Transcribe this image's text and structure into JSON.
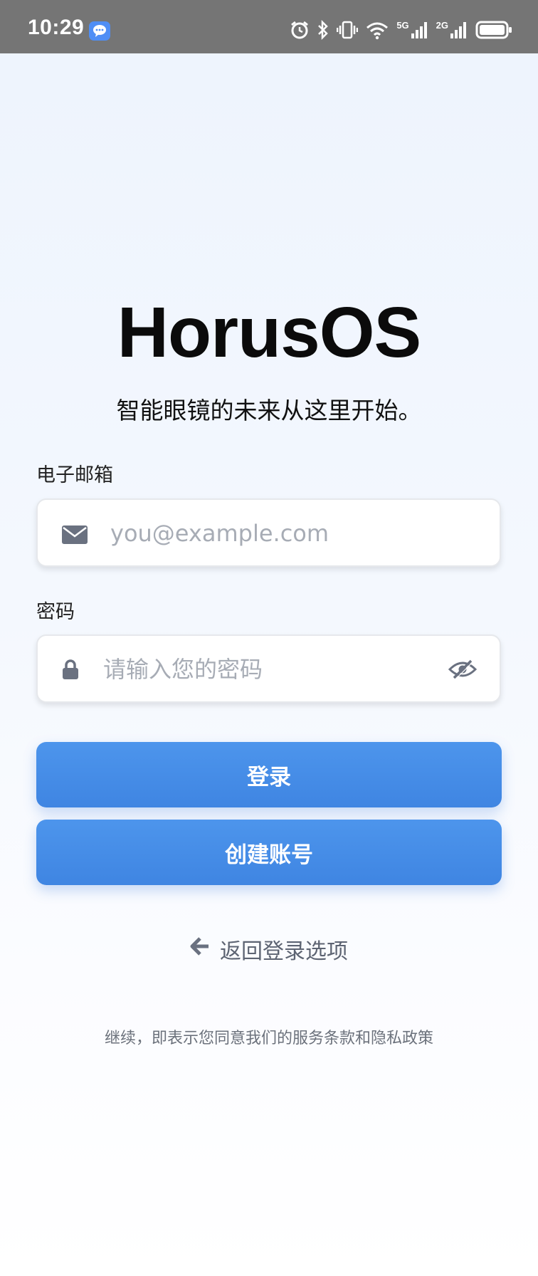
{
  "status_bar": {
    "time": "10:29",
    "network_5g": "5G",
    "network_2g": "2G"
  },
  "app": {
    "brand": "HorusOS",
    "tagline": "智能眼镜的未来从这里开始。"
  },
  "form": {
    "email_label": "电子邮箱",
    "email_placeholder": "you@example.com",
    "password_label": "密码",
    "password_placeholder": "请输入您的密码"
  },
  "buttons": {
    "login": "登录",
    "create_account": "创建账号"
  },
  "back_link": "返回登录选项",
  "terms": "继续，即表示您同意我们的服务条款和隐私政策",
  "icons": {
    "email": "envelope-icon",
    "password": "lock-icon",
    "toggle_visibility": "eye-slash-icon",
    "back": "arrow-left-icon"
  },
  "colors": {
    "primary": "#4a8fe8",
    "status_bar": "#757575"
  }
}
